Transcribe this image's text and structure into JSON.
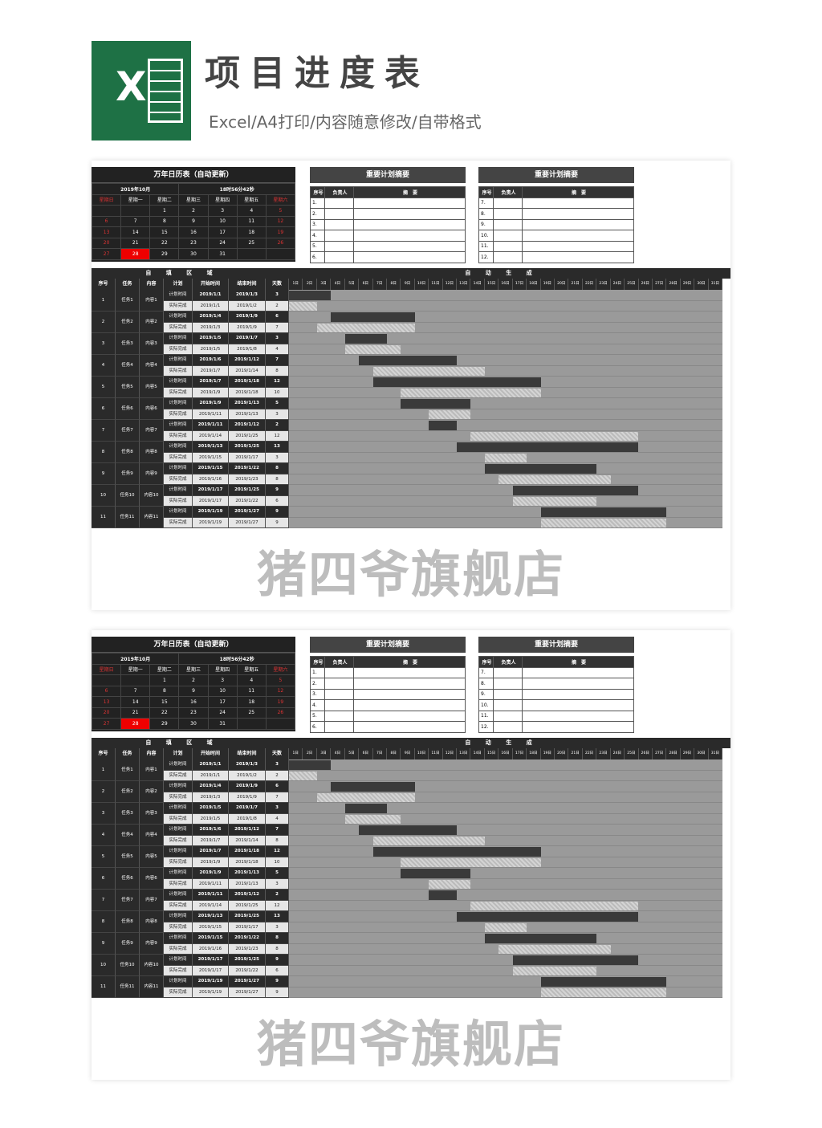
{
  "header": {
    "title": "项目进度表",
    "subtitle": "Excel/A4打印/内容随意修改/自带格式"
  },
  "calendar": {
    "title": "万年日历表（自动更新）",
    "month": "2019年10月",
    "time": "18时56分42秒",
    "weekdays": [
      "星期日",
      "星期一",
      "星期二",
      "星期三",
      "星期四",
      "星期五",
      "星期六"
    ],
    "weeks": [
      [
        "",
        "",
        "1",
        "2",
        "3",
        "4",
        "5"
      ],
      [
        "6",
        "7",
        "8",
        "9",
        "10",
        "11",
        "12"
      ],
      [
        "13",
        "14",
        "15",
        "16",
        "17",
        "18",
        "19"
      ],
      [
        "20",
        "21",
        "22",
        "23",
        "24",
        "25",
        "26"
      ],
      [
        "27",
        "28",
        "29",
        "30",
        "31",
        "",
        ""
      ]
    ],
    "today": "28"
  },
  "summary": {
    "title": "重要计划摘要",
    "headers": [
      "序号",
      "负责人",
      "摘　要"
    ],
    "left": [
      "1.",
      "2.",
      "3.",
      "4.",
      "5.",
      "6."
    ],
    "right": [
      "7.",
      "8.",
      "9.",
      "10.",
      "11.",
      "12."
    ]
  },
  "gantt": {
    "band_left": "自 填 区 域",
    "band_right": "自 动 生 成",
    "headers": [
      "序号",
      "任务",
      "内容",
      "计划",
      "开始时间",
      "结束时间",
      "天数"
    ],
    "days": [
      "1日",
      "2日",
      "3日",
      "4日",
      "5日",
      "6日",
      "7日",
      "8日",
      "9日",
      "10日",
      "11日",
      "12日",
      "13日",
      "14日",
      "15日",
      "16日",
      "17日",
      "18日",
      "19日",
      "20日",
      "21日",
      "22日",
      "23日",
      "24日",
      "25日",
      "26日",
      "27日",
      "28日",
      "29日",
      "30日",
      "31日"
    ],
    "plan_label": "计划时间",
    "actual_label": "实际完成",
    "tasks": [
      {
        "no": "1",
        "task": "任务1",
        "content": "内容1",
        "plan": [
          "2019/1/1",
          "2019/1/3",
          "3"
        ],
        "actual": [
          "2019/1/1",
          "2019/1/2",
          "2"
        ],
        "ps": 1,
        "pd": 3,
        "as": 1,
        "ad": 2
      },
      {
        "no": "2",
        "task": "任务2",
        "content": "内容2",
        "plan": [
          "2019/1/4",
          "2019/1/9",
          "6"
        ],
        "actual": [
          "2019/1/3",
          "2019/1/9",
          "7"
        ],
        "ps": 4,
        "pd": 6,
        "as": 3,
        "ad": 7
      },
      {
        "no": "3",
        "task": "任务3",
        "content": "内容3",
        "plan": [
          "2019/1/5",
          "2019/1/7",
          "3"
        ],
        "actual": [
          "2019/1/5",
          "2019/1/8",
          "4"
        ],
        "ps": 5,
        "pd": 3,
        "as": 5,
        "ad": 4
      },
      {
        "no": "4",
        "task": "任务4",
        "content": "内容4",
        "plan": [
          "2019/1/6",
          "2019/1/12",
          "7"
        ],
        "actual": [
          "2019/1/7",
          "2019/1/14",
          "8"
        ],
        "ps": 6,
        "pd": 7,
        "as": 7,
        "ad": 8
      },
      {
        "no": "5",
        "task": "任务5",
        "content": "内容5",
        "plan": [
          "2019/1/7",
          "2019/1/18",
          "12"
        ],
        "actual": [
          "2019/1/9",
          "2019/1/18",
          "10"
        ],
        "ps": 7,
        "pd": 12,
        "as": 9,
        "ad": 10
      },
      {
        "no": "6",
        "task": "任务6",
        "content": "内容6",
        "plan": [
          "2019/1/9",
          "2019/1/13",
          "5"
        ],
        "actual": [
          "2019/1/11",
          "2019/1/13",
          "3"
        ],
        "ps": 9,
        "pd": 5,
        "as": 11,
        "ad": 3
      },
      {
        "no": "7",
        "task": "任务7",
        "content": "内容7",
        "plan": [
          "2019/1/11",
          "2019/1/12",
          "2"
        ],
        "actual": [
          "2019/1/14",
          "2019/1/25",
          "12"
        ],
        "ps": 11,
        "pd": 2,
        "as": 14,
        "ad": 12
      },
      {
        "no": "8",
        "task": "任务8",
        "content": "内容8",
        "plan": [
          "2019/1/13",
          "2019/1/25",
          "13"
        ],
        "actual": [
          "2019/1/15",
          "2019/1/17",
          "3"
        ],
        "ps": 13,
        "pd": 13,
        "as": 15,
        "ad": 3
      },
      {
        "no": "9",
        "task": "任务9",
        "content": "内容9",
        "plan": [
          "2019/1/15",
          "2019/1/22",
          "8"
        ],
        "actual": [
          "2019/1/16",
          "2019/1/23",
          "8"
        ],
        "ps": 15,
        "pd": 8,
        "as": 16,
        "ad": 8
      },
      {
        "no": "10",
        "task": "任务10",
        "content": "内容10",
        "plan": [
          "2019/1/17",
          "2019/1/25",
          "9"
        ],
        "actual": [
          "2019/1/17",
          "2019/1/22",
          "6"
        ],
        "ps": 17,
        "pd": 9,
        "as": 17,
        "ad": 6
      },
      {
        "no": "11",
        "task": "任务11",
        "content": "内容11",
        "plan": [
          "2019/1/19",
          "2019/1/27",
          "9"
        ],
        "actual": [
          "2019/1/19",
          "2019/1/27",
          "9"
        ],
        "ps": 19,
        "pd": 9,
        "as": 19,
        "ad": 9
      }
    ]
  },
  "watermark": "猪四爷旗舰店"
}
